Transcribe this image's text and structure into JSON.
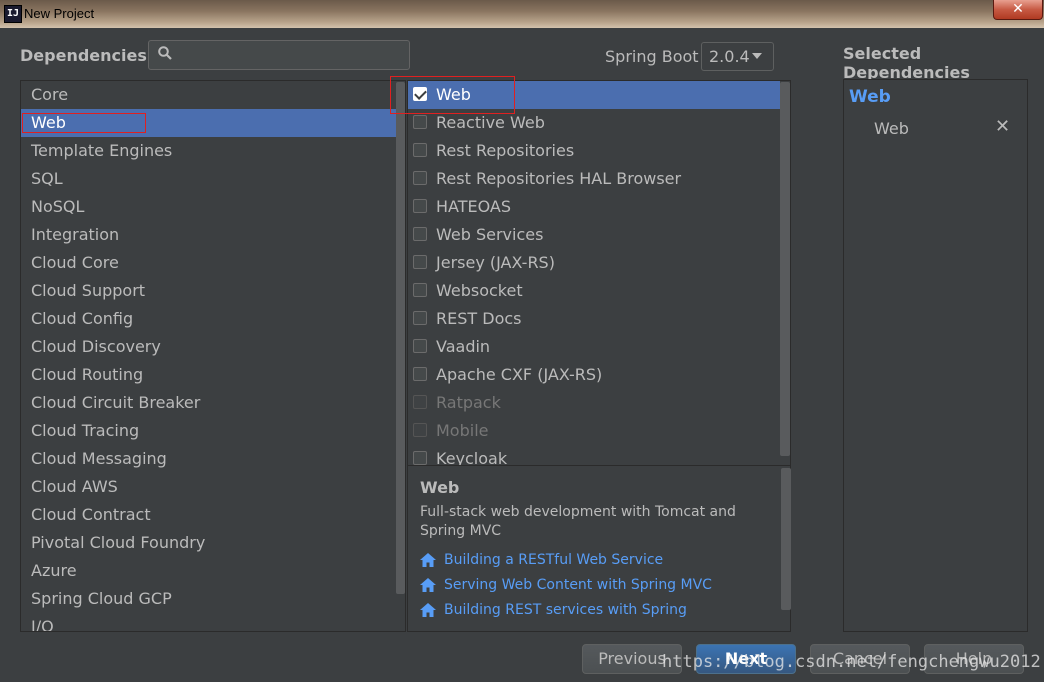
{
  "window": {
    "title": "New Project",
    "app_icon_text": "IJ",
    "close_glyph": "✕"
  },
  "header": {
    "dependencies_label": "Dependencies",
    "search_value": "",
    "spring_boot_label": "Spring Boot",
    "spring_boot_version": "2.0.4",
    "selected_label": "Selected Dependencies"
  },
  "categories": [
    {
      "label": "Core"
    },
    {
      "label": "Web"
    },
    {
      "label": "Template Engines"
    },
    {
      "label": "SQL"
    },
    {
      "label": "NoSQL"
    },
    {
      "label": "Integration"
    },
    {
      "label": "Cloud Core"
    },
    {
      "label": "Cloud Support"
    },
    {
      "label": "Cloud Config"
    },
    {
      "label": "Cloud Discovery"
    },
    {
      "label": "Cloud Routing"
    },
    {
      "label": "Cloud Circuit Breaker"
    },
    {
      "label": "Cloud Tracing"
    },
    {
      "label": "Cloud Messaging"
    },
    {
      "label": "Cloud AWS"
    },
    {
      "label": "Cloud Contract"
    },
    {
      "label": "Pivotal Cloud Foundry"
    },
    {
      "label": "Azure"
    },
    {
      "label": "Spring Cloud GCP"
    },
    {
      "label": "I/O"
    }
  ],
  "selected_category": "Web",
  "dependencies": [
    {
      "label": "Web",
      "checked": true,
      "enabled": true
    },
    {
      "label": "Reactive Web",
      "checked": false,
      "enabled": true
    },
    {
      "label": "Rest Repositories",
      "checked": false,
      "enabled": true
    },
    {
      "label": "Rest Repositories HAL Browser",
      "checked": false,
      "enabled": true
    },
    {
      "label": "HATEOAS",
      "checked": false,
      "enabled": true
    },
    {
      "label": "Web Services",
      "checked": false,
      "enabled": true
    },
    {
      "label": "Jersey (JAX-RS)",
      "checked": false,
      "enabled": true
    },
    {
      "label": "Websocket",
      "checked": false,
      "enabled": true
    },
    {
      "label": "REST Docs",
      "checked": false,
      "enabled": true
    },
    {
      "label": "Vaadin",
      "checked": false,
      "enabled": true
    },
    {
      "label": "Apache CXF (JAX-RS)",
      "checked": false,
      "enabled": true
    },
    {
      "label": "Ratpack",
      "checked": false,
      "enabled": false
    },
    {
      "label": "Mobile",
      "checked": false,
      "enabled": false
    },
    {
      "label": "Keycloak",
      "checked": false,
      "enabled": true
    }
  ],
  "selected_dependency": "Web",
  "description": {
    "title": "Web",
    "text": "Full-stack web development with Tomcat and Spring MVC",
    "links": [
      {
        "label": "Building a RESTful Web Service",
        "icon": "home-icon"
      },
      {
        "label": "Serving Web Content with Spring MVC",
        "icon": "home-icon"
      },
      {
        "label": "Building REST services with Spring",
        "icon": "home-icon"
      }
    ]
  },
  "selected_dependencies": {
    "group": "Web",
    "items": [
      {
        "label": "Web",
        "remove_glyph": "✕"
      }
    ]
  },
  "buttons": {
    "previous": "Previous",
    "next": "Next",
    "cancel": "Cancel",
    "help": "Help"
  },
  "watermark": "https://blog.csdn.net/fengchengwu2012",
  "colors": {
    "accent": "#4b6eaf",
    "link": "#589df6",
    "background": "#3c3f41",
    "highlight_box": "#e02020"
  }
}
